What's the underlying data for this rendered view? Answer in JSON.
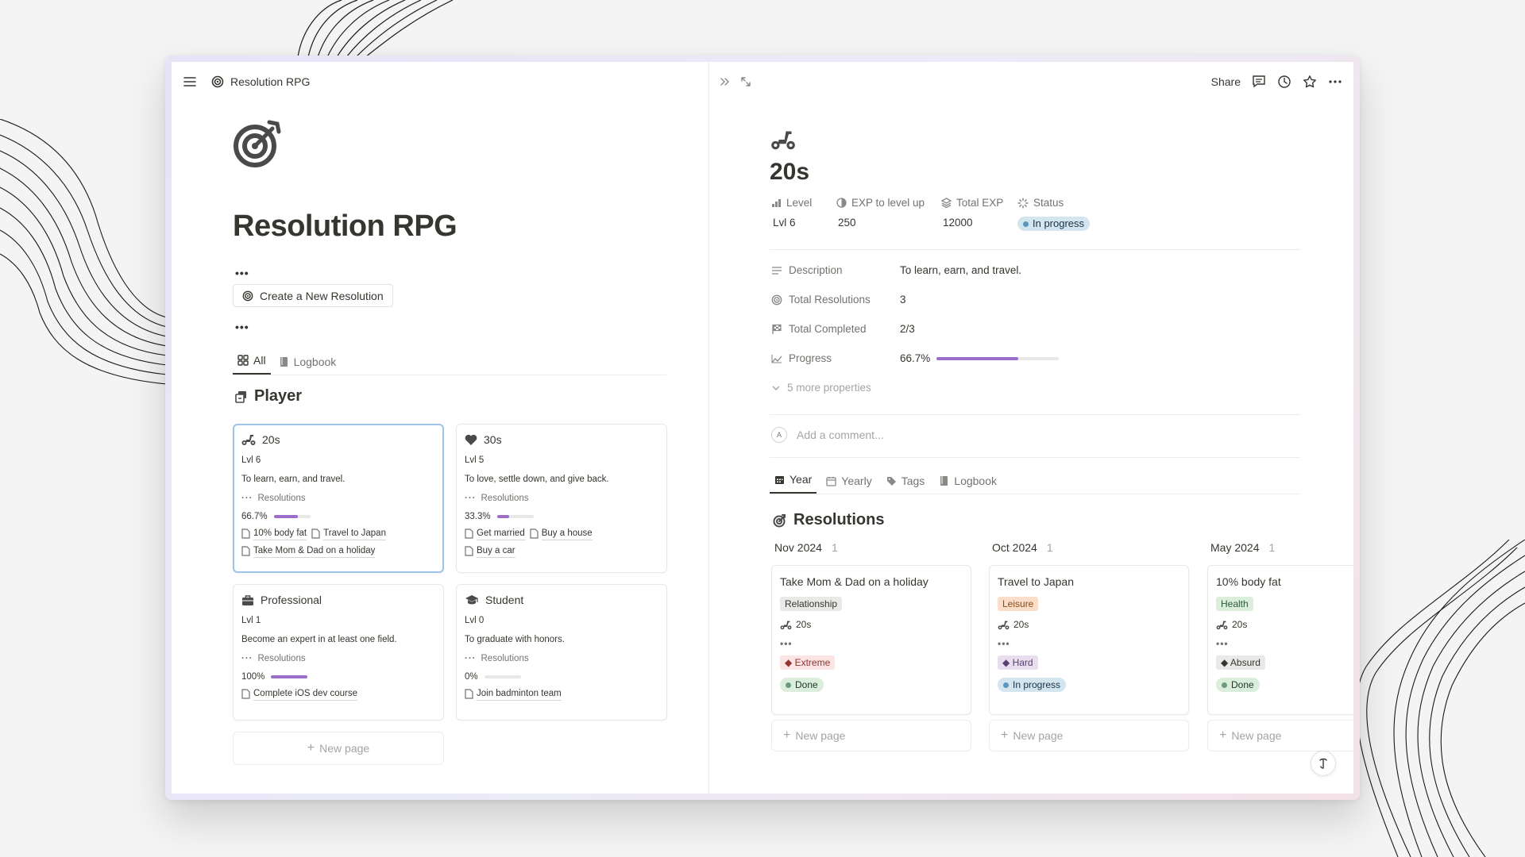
{
  "colors": {
    "accent": "#9b6ec9",
    "selected_border": "#9fc3e6",
    "muted_text": "#73726e"
  },
  "topbar": {
    "title": "Resolution RPG",
    "share_label": "Share"
  },
  "left": {
    "title": "Resolution RPG",
    "dots_top": "•••",
    "dots_bottom": "•••",
    "new_button_label": "Create a New Resolution",
    "tabs": [
      {
        "label": "All",
        "icon": "grid-icon"
      },
      {
        "label": "Logbook",
        "icon": "book-icon"
      }
    ],
    "section_title": "Player",
    "cards": [
      {
        "title": "20s",
        "icon": "scooter-icon",
        "level": "Lvl 6",
        "description": "To learn, earn, and travel.",
        "prop_label": "Resolutions",
        "progress_label": "66.7%",
        "progress": 0.667,
        "relations": [
          "10% body fat",
          "Travel to Japan",
          "Take Mom & Dad on a holiday"
        ]
      },
      {
        "title": "30s",
        "icon": "heart-icon",
        "level": "Lvl 5",
        "description": "To love, settle down, and give back.",
        "prop_label": "Resolutions",
        "progress_label": "33.3%",
        "progress": 0.333,
        "relations": [
          "Get married",
          "Buy a house",
          "Buy a car"
        ]
      },
      {
        "title": "Professional",
        "icon": "briefcase-icon",
        "level": "Lvl 1",
        "description": "Become an expert in at least one field.",
        "prop_label": "Resolutions",
        "progress_label": "100%",
        "progress": 1.0,
        "relations": [
          "Complete iOS dev course"
        ]
      },
      {
        "title": "Student",
        "icon": "graduation-cap-icon",
        "level": "Lvl 0",
        "description": "To graduate with honors.",
        "prop_label": "Resolutions",
        "progress_label": "0%",
        "progress": 0.0,
        "relations": [
          "Join badminton team"
        ]
      }
    ],
    "new_page_label": "New page"
  },
  "right": {
    "page_title": "20s",
    "props": {
      "level_label": "Level",
      "level_value": "Lvl 6",
      "exp_label": "EXP to level up",
      "exp_value": "250",
      "total_exp_label": "Total EXP",
      "total_exp_value": "12000",
      "status_label": "Status",
      "status_value": "In progress"
    },
    "details": [
      {
        "label": "Description",
        "value": "To learn, earn, and travel.",
        "icon": "lines-icon"
      },
      {
        "label": "Total Resolutions",
        "value": "3",
        "icon": "target-icon"
      },
      {
        "label": "Total Completed",
        "value": "2/3",
        "icon": "checkered-flag-icon"
      },
      {
        "label": "Progress",
        "value": "66.7%",
        "icon": "trend-icon",
        "progress": 0.667
      }
    ],
    "more_props_label": "5 more properties",
    "comment_placeholder": "Add a comment...",
    "avatar_letter": "A",
    "tabs": [
      {
        "label": "Year"
      },
      {
        "label": "Yearly"
      },
      {
        "label": "Tags"
      },
      {
        "label": "Logbook"
      }
    ],
    "section_title": "Resolutions",
    "columns": [
      {
        "header": "Nov 2024",
        "count": "1",
        "card": {
          "title": "Take Mom & Dad on a holiday",
          "tag": "Relationship",
          "tag_bg": "#e9e9e7",
          "tag_fg": "#37352f",
          "relation": "20s",
          "difficulty": "Extreme",
          "diff_bg": "#fbe4e4",
          "diff_fg": "#93342f",
          "status": "Done",
          "status_bg": "#dbeddb",
          "status_dot": "#6c9b7d"
        }
      },
      {
        "header": "Oct 2024",
        "count": "1",
        "card": {
          "title": "Travel to Japan",
          "tag": "Leisure",
          "tag_bg": "#fadec9",
          "tag_fg": "#8a4b19",
          "relation": "20s",
          "difficulty": "Hard",
          "diff_bg": "#e8deee",
          "diff_fg": "#5a3f73",
          "status": "In progress",
          "status_bg": "#d3e5ef",
          "status_dot": "#5b97bd"
        }
      },
      {
        "header": "May 2024",
        "count": "1",
        "card": {
          "title": "10% body fat",
          "tag": "Health",
          "tag_bg": "#dbeddb",
          "tag_fg": "#2b5b3b",
          "relation": "20s",
          "difficulty": "Absurd",
          "diff_bg": "#e9e9e7",
          "diff_fg": "#37352f",
          "status": "Done",
          "status_bg": "#dbeddb",
          "status_dot": "#6c9b7d"
        }
      }
    ],
    "new_page_label": "New page",
    "kanban_dots": "•••"
  }
}
